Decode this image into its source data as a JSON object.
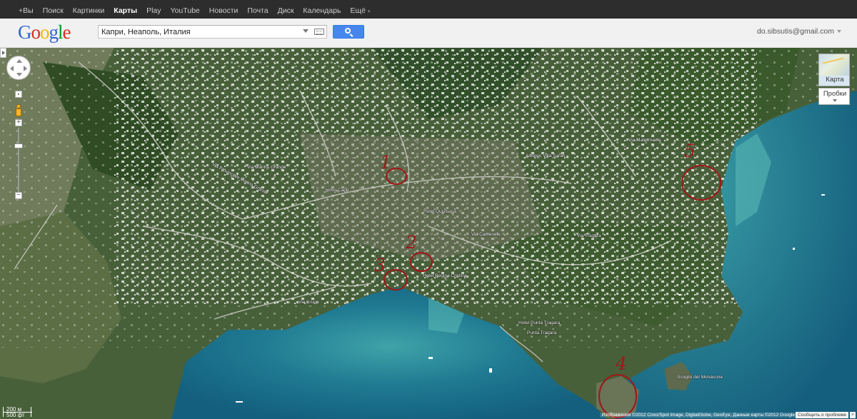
{
  "topbar": {
    "items": [
      "+Вы",
      "Поиск",
      "Картинки",
      "Карты",
      "Play",
      "YouTube",
      "Новости",
      "Почта",
      "Диск",
      "Календарь",
      "Ещё"
    ],
    "active": "Карты"
  },
  "header": {
    "logo": "Google",
    "search_value": "Капри, Неаполь, Италия",
    "account": "do.sibsutis@gmail.com"
  },
  "map": {
    "view": "satellite",
    "location": "Капри",
    "map_type_label": "Карта",
    "traffic_label": "Пробки",
    "scale": [
      "200 м",
      "500 фт"
    ],
    "copyright": "Изображения ©2012 Cnes/Spot Image, DigitalGlobe, GeoEye, Данные карты ©2012 Google",
    "report_link": "Сообщить о проблеме",
    "report_close": "×",
    "places": [
      "Hotel Capri",
      "Hotel Quisisana",
      "Hotel Regina Cristina",
      "Hotel Punta Tragara",
      "Punta Tragara",
      "Scoglio del Monacone",
      "Albergo Villa Sarah",
      "Via Marina Grande",
      "Via Krupp",
      "Via Provinciale Marina Grande",
      "Via Tragara",
      "Via Camerelle",
      "Via Matermania"
    ],
    "annotations": [
      "1",
      "2",
      "3",
      "4",
      "5"
    ]
  }
}
